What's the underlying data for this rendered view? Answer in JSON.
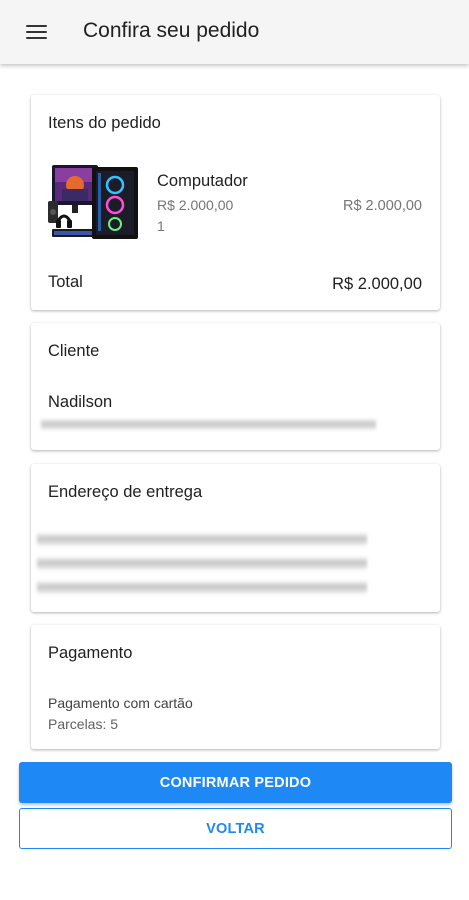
{
  "appbar": {
    "title": "Confira seu pedido",
    "menu_icon": "hamburger-menu-icon"
  },
  "items_card": {
    "title": "Itens do pedido",
    "items": [
      {
        "image": "gaming-computer-image",
        "name": "Computador",
        "unit_price": "R$ 2.000,00",
        "quantity": "1",
        "subtotal": "R$ 2.000,00"
      }
    ],
    "total_label": "Total",
    "total_value": "R$ 2.000,00"
  },
  "client_card": {
    "title": "Cliente",
    "name": "Nadilson"
  },
  "address_card": {
    "title": "Endereço de entrega"
  },
  "payment_card": {
    "title": "Pagamento",
    "method": "Pagamento com cartão",
    "installments": "Parcelas: 5"
  },
  "actions": {
    "confirm_label": "CONFIRMAR PEDIDO",
    "back_label": "VOLTAR"
  },
  "colors": {
    "primary": "#1e88f5",
    "appbar_bg": "#f5f5f5",
    "text": "#212121",
    "secondary_text": "#757575"
  }
}
